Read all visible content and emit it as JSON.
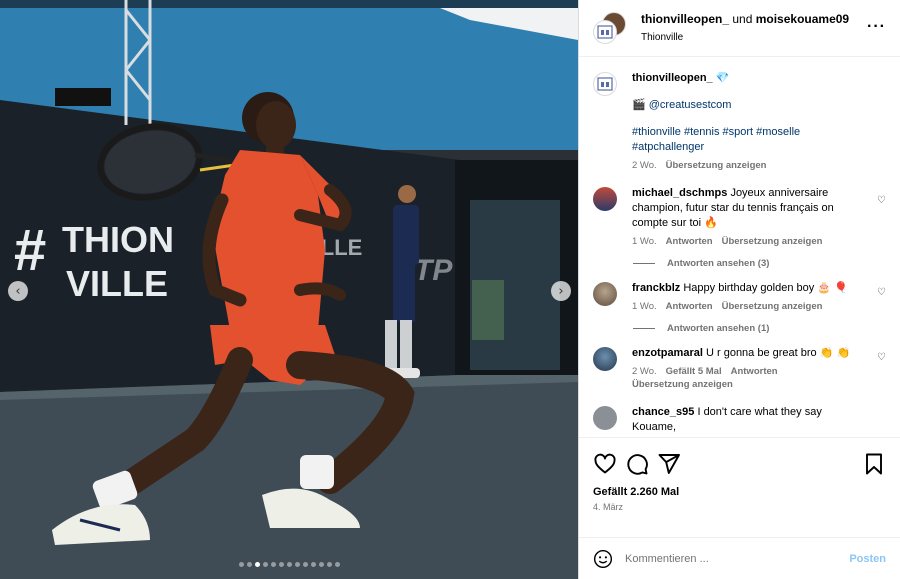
{
  "post": {
    "photo_text": {
      "hash": "#",
      "line1": "THION",
      "line2": "VILLE"
    },
    "carousel": {
      "total": 13,
      "active": 2
    }
  },
  "header": {
    "user1": "thionvilleopen_",
    "joiner": " und ",
    "user2": "moisekouame09",
    "location": "Thionville",
    "more_icon": "more-horizontal-icon"
  },
  "caption": {
    "username": "thionvilleopen_",
    "badge": "💎",
    "clapper": "🎬",
    "mention": "@creatusestcom",
    "hashtags": "#thionville #tennis #sport #moselle #atpchallenger",
    "time": "2 Wo.",
    "translate": "Übersetzung anzeigen"
  },
  "comments": [
    {
      "username": "michael_dschmps",
      "text": "Joyeux anniversaire champion, futur star du tennis français on compte sur toi 🔥",
      "time": "1 Wo.",
      "reply": "Antworten",
      "translate": "Übersetzung anzeigen",
      "replies": "Antworten ansehen (3)"
    },
    {
      "username": "franckblz",
      "text": "Happy birthday golden boy 🎂 🎈",
      "time": "1 Wo.",
      "reply": "Antworten",
      "translate": "Übersetzung anzeigen",
      "replies": "Antworten ansehen (1)"
    },
    {
      "username": "enzotpamaral",
      "text": "U r gonna be great bro 👏 👏",
      "time": "2 Wo.",
      "likes": "Gefällt 5 Mal",
      "reply": "Antworten",
      "translate": "Übersetzung anzeigen"
    },
    {
      "username": "chance_s95",
      "text": "I don't care what they say Kouame,"
    }
  ],
  "actions": {
    "likes": "Gefällt 2.260 Mal",
    "date": "4. März"
  },
  "comment_box": {
    "placeholder": "Kommentieren ...",
    "post": "Posten"
  },
  "colors": {
    "link": "#00376b",
    "post_button": "#8cc6f5",
    "meta": "#737373"
  }
}
